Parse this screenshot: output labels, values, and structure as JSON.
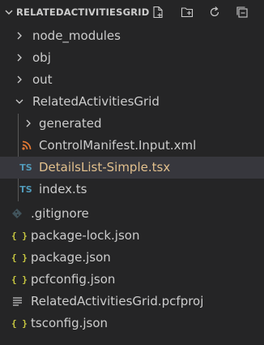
{
  "explorer": {
    "title": "RELATEDACTIVITIESGRID",
    "actions": {
      "new_file": "new-file-icon",
      "new_folder": "new-folder-icon",
      "refresh": "refresh-icon",
      "collapse_all": "collapse-all-icon"
    }
  },
  "tree": {
    "node_modules": "node_modules",
    "obj": "obj",
    "out": "out",
    "folder": "RelatedActivitiesGrid",
    "generated": "generated",
    "manifest": "ControlManifest.Input.xml",
    "details_list": "DetailsList-Simple.tsx",
    "index": "index.ts",
    "gitignore": ".gitignore",
    "package_lock": "package-lock.json",
    "package": "package.json",
    "pcfconfig": "pcfconfig.json",
    "pcfproj": "RelatedActivitiesGrid.pcfproj",
    "tsconfig": "tsconfig.json"
  },
  "icons": {
    "ts_label": "TS",
    "json_label": "{ }"
  },
  "colors": {
    "background": "#252526",
    "selected_row": "#37373d",
    "selected_text": "#e2c08d",
    "ts_blue": "#519aba",
    "json_yellow": "#cbcb41",
    "xml_orange": "#e37933",
    "git_gray": "#41535b"
  },
  "selected_item": "DetailsList-Simple.tsx"
}
